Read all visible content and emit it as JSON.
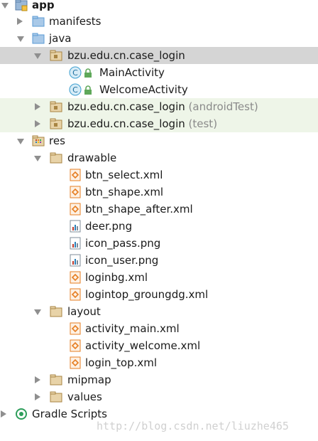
{
  "project_tree": {
    "app": "app",
    "manifests": "manifests",
    "java": "java",
    "package_main": "bzu.edu.cn.case_login",
    "main_activity": "MainActivity",
    "welcome_activity": "WelcomeActivity",
    "package_android_test": "bzu.edu.cn.case_login",
    "android_test_suffix": "(androidTest)",
    "package_test": "bzu.edu.cn.case_login",
    "test_suffix": "(test)",
    "res": "res",
    "drawable": "drawable",
    "drawable_files": [
      "btn_select.xml",
      "btn_shape.xml",
      "btn_shape_after.xml",
      "deer.png",
      "icon_pass.png",
      "icon_user.png",
      "loginbg.xml",
      "logintop_groungdg.xml"
    ],
    "layout": "layout",
    "layout_files": [
      "activity_main.xml",
      "activity_welcome.xml",
      "login_top.xml"
    ],
    "mipmap": "mipmap",
    "values": "values",
    "gradle_scripts": "Gradle Scripts"
  },
  "watermark": "http://blog.csdn.net/liuzhe465",
  "colors": {
    "selected_row": "#d5d5d5",
    "test_row": "#eef5e8",
    "folder_blue": "#5b9bd5",
    "package_tan": "#c9a873",
    "class_badge": "#3d9fd0",
    "xml_orange": "#e67e22"
  }
}
